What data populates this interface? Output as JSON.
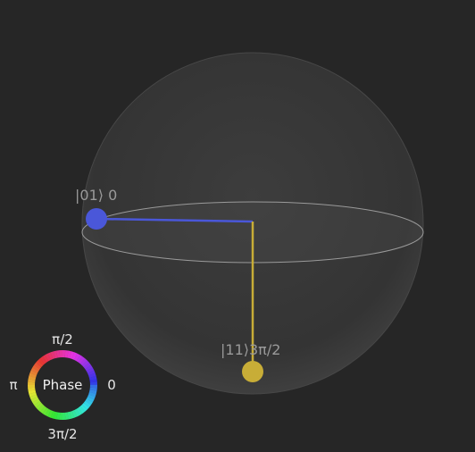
{
  "states": [
    {
      "ket": "|01⟩",
      "phase_text": "0",
      "color": "#4a57d9"
    },
    {
      "ket": "|11⟩",
      "phase_text": "3π/2",
      "color": "#c8ad37"
    }
  ],
  "phase_wheel": {
    "center_label": "Phase",
    "top": "π/2",
    "left": "π",
    "right": "0",
    "bottom": "3π/2"
  },
  "colors": {
    "background": "#262626",
    "sphere_fill": "#3a3a3a",
    "equator": "#8a8a8a"
  }
}
